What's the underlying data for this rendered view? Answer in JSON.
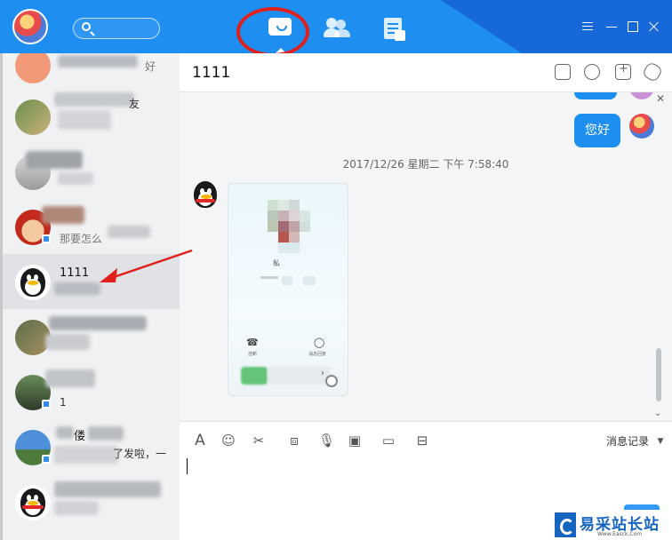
{
  "header": {
    "tabs": [
      {
        "name": "messages",
        "icon": "chat-bubble-icon",
        "active": true
      },
      {
        "name": "contacts",
        "icon": "contacts-icon",
        "active": false
      },
      {
        "name": "documents",
        "icon": "document-icon",
        "active": false
      }
    ],
    "window_controls": [
      "menu-icon",
      "minimize-icon",
      "maximize-icon",
      "close-icon"
    ]
  },
  "sidebar": {
    "contacts": [
      {
        "name": "",
        "preview": "好"
      },
      {
        "name": "",
        "preview": "友"
      },
      {
        "name": "",
        "preview": ""
      },
      {
        "name": "",
        "preview": "那要怎么"
      },
      {
        "name": "1111",
        "preview": ""
      },
      {
        "name": "",
        "preview": ""
      },
      {
        "name": "",
        "preview": "1"
      },
      {
        "name": "偻",
        "preview": "了发啦，一"
      },
      {
        "name": "",
        "preview": ""
      }
    ]
  },
  "chat": {
    "title": "1111",
    "messages": [
      {
        "from": "self",
        "text": "您好"
      }
    ],
    "timestamp": "2017/12/26 星期二 下午 7:58:40",
    "image_text": {
      "line1": "私",
      "button1": "挂断",
      "button2": "消息回复"
    }
  },
  "toolbar": {
    "history_label": "消息记录"
  },
  "watermark": {
    "site": "易采站长站",
    "url": "Www.Easck.Com"
  },
  "colors": {
    "accent": "#1e8ff0",
    "header_dark": "#1768d8",
    "annotation_red": "#e0201c"
  }
}
